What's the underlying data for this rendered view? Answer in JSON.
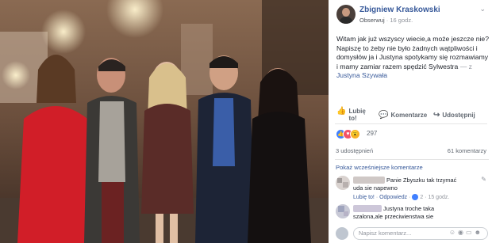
{
  "post": {
    "author": "Zbigniew Kraskowski",
    "follow_label": "Obserwuj",
    "separator": "·",
    "time": "16 godz.",
    "text": "Witam jak już wszyscy wiecie,a może jeszcze nie? Napiszę to żeby nie było żadnych wątpliwości i domysłów ja i Justyna spotykamy się rozmawiamy i mamy zamiar razem spędzić Sylwestra",
    "with_prefix": "— z",
    "tagged": "Justyna Szywała"
  },
  "actions": {
    "like_label": "Lubię to!",
    "comment_label": "Komentarze",
    "share_label": "Udostępnij"
  },
  "reactions": {
    "count": "297",
    "icons": [
      {
        "name": "like-reaction-icon",
        "glyph": "👍",
        "color": "#4080ff"
      },
      {
        "name": "love-reaction-icon",
        "glyph": "♥",
        "color": "#f25268"
      },
      {
        "name": "wow-reaction-icon",
        "glyph": "😮",
        "color": "#f7b125"
      }
    ]
  },
  "stats": {
    "shares": "3 udostępnień",
    "comments": "61 komentarzy"
  },
  "comments": {
    "show_previous": "Pokaż wcześniejsze komentarze",
    "items": [
      {
        "text_line1": "Panie Zbyszku tak trzymać",
        "text_line2": "uda sie napewno",
        "like": "Lubię to!",
        "reply": "Odpowiedz",
        "likes": "2",
        "time": "15 godz."
      },
      {
        "text_line1": "Justyna troche taka",
        "text_line2": "szalona,ale przeciwienstwa sie"
      }
    ],
    "input_placeholder": "Napisz komentarz..."
  },
  "colors": {
    "link": "#365899",
    "text": "#1d2129",
    "muted": "#90949c"
  }
}
